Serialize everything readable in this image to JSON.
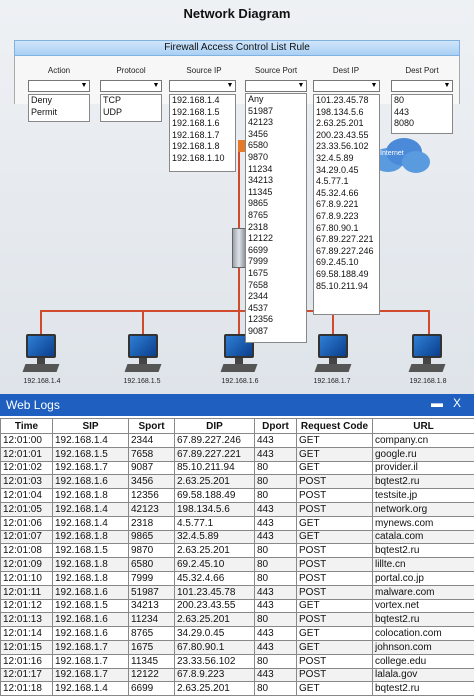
{
  "diagram": {
    "title": "Network Diagram",
    "firewall_panel_title": "Firewall Access Control List Rule",
    "columns": {
      "action": {
        "label": "Action",
        "options": [
          "Deny",
          "Permit"
        ]
      },
      "protocol": {
        "label": "Protocol",
        "options": [
          "TCP",
          "UDP"
        ]
      },
      "source_ip": {
        "label": "Source IP",
        "options": [
          "192.168.1.4",
          "192.168.1.5",
          "192.168.1.6",
          "192.168.1.7",
          "192.168.1.8",
          "192.168.1.10"
        ]
      },
      "source_port": {
        "label": "Source Port",
        "options": [
          "Any",
          "51987",
          "42123",
          "3456",
          "6580",
          "9870",
          "11234",
          "34213",
          "11345",
          "9865",
          "8765",
          "2318",
          "12122",
          "6699",
          "7999",
          "1675",
          "7658",
          "2344",
          "4537",
          "12356",
          "9087"
        ]
      },
      "dest_ip": {
        "label": "Dest IP",
        "options": [
          "101.23.45.78",
          "198.134.5.6",
          "2.63.25.201",
          "200.23.43.55",
          "23.33.56.102",
          "32.4.5.89",
          "34.29.0.45",
          "4.5.77.1",
          "45.32.4.66",
          "67.8.9.221",
          "67.8.9.223",
          "67.80.90.1",
          "67.89.227.221",
          "67.89.227.246",
          "69.2.45.10",
          "69.58.188.49",
          "85.10.211.94"
        ]
      },
      "dest_port": {
        "label": "Dest Port",
        "options": [
          "80",
          "443",
          "8080"
        ]
      }
    },
    "cloud_label": "Internet",
    "hosts": [
      "192.168.1.4",
      "192.168.1.5",
      "192.168.1.6",
      "192.168.1.7",
      "192.168.1.8"
    ]
  },
  "weblogs": {
    "title": "Web Logs",
    "minimize_label": "▬",
    "close_label": "X",
    "headers": [
      "Time",
      "SIP",
      "Sport",
      "DIP",
      "Dport",
      "Request Code",
      "URL"
    ],
    "rows": [
      [
        "12:01:00",
        "192.168.1.4",
        "2344",
        "67.89.227.246",
        "443",
        "GET",
        "company.cn"
      ],
      [
        "12:01:01",
        "192.168.1.5",
        "7658",
        "67.89.227.221",
        "443",
        "GET",
        "google.ru"
      ],
      [
        "12:01:02",
        "192.168.1.7",
        "9087",
        "85.10.211.94",
        "80",
        "GET",
        "provider.il"
      ],
      [
        "12:01:03",
        "192.168.1.6",
        "3456",
        "2.63.25.201",
        "80",
        "POST",
        "bqtest2.ru"
      ],
      [
        "12:01:04",
        "192.168.1.8",
        "12356",
        "69.58.188.49",
        "80",
        "POST",
        "testsite.jp"
      ],
      [
        "12:01:05",
        "192.168.1.4",
        "42123",
        "198.134.5.6",
        "443",
        "POST",
        "network.org"
      ],
      [
        "12:01:06",
        "192.168.1.4",
        "2318",
        "4.5.77.1",
        "443",
        "GET",
        "mynews.com"
      ],
      [
        "12:01:07",
        "192.168.1.8",
        "9865",
        "32.4.5.89",
        "443",
        "GET",
        "catala.com"
      ],
      [
        "12:01:08",
        "192.168.1.5",
        "9870",
        "2.63.25.201",
        "80",
        "POST",
        "bqtest2.ru"
      ],
      [
        "12:01:09",
        "192.168.1.8",
        "6580",
        "69.2.45.10",
        "80",
        "POST",
        "lillte.cn"
      ],
      [
        "12:01:10",
        "192.168.1.8",
        "7999",
        "45.32.4.66",
        "80",
        "POST",
        "portal.co.jp"
      ],
      [
        "12:01:11",
        "192.168.1.6",
        "51987",
        "101.23.45.78",
        "443",
        "POST",
        "malware.com"
      ],
      [
        "12:01:12",
        "192.168.1.5",
        "34213",
        "200.23.43.55",
        "443",
        "GET",
        "vortex.net"
      ],
      [
        "12:01:13",
        "192.168.1.6",
        "11234",
        "2.63.25.201",
        "80",
        "POST",
        "bqtest2.ru"
      ],
      [
        "12:01:14",
        "192.168.1.6",
        "8765",
        "34.29.0.45",
        "443",
        "GET",
        "colocation.com"
      ],
      [
        "12:01:15",
        "192.168.1.7",
        "1675",
        "67.80.90.1",
        "443",
        "GET",
        "johnson.com"
      ],
      [
        "12:01:16",
        "192.168.1.7",
        "11345",
        "23.33.56.102",
        "80",
        "POST",
        "college.edu"
      ],
      [
        "12:01:17",
        "192.168.1.7",
        "12122",
        "67.8.9.223",
        "443",
        "POST",
        "lalala.gov"
      ],
      [
        "12:01:18",
        "192.168.1.4",
        "6699",
        "2.63.25.201",
        "80",
        "GET",
        "bqtest2.ru"
      ]
    ]
  }
}
